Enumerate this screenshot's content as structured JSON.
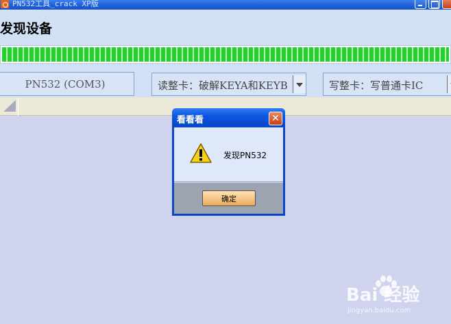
{
  "window": {
    "title": "PN532工具_crack XP版",
    "icon": "app-icon"
  },
  "header": {
    "status_text": "发现设备",
    "progress_percent": 100,
    "progress_color": "#22d42a"
  },
  "controls": {
    "port": "PN532 (COM3)",
    "read_mode": "读整卡：破解KEYA和KEYB",
    "write_mode": "写整卡：写普通卡IC"
  },
  "dialog": {
    "title": "看看看",
    "message": "发现PN532",
    "ok_label": "确定",
    "icon": "warning-icon",
    "title_color": "#0b57e0"
  },
  "watermark": {
    "logo": "Bai 经验",
    "url": "jingyan.baidu.com"
  }
}
